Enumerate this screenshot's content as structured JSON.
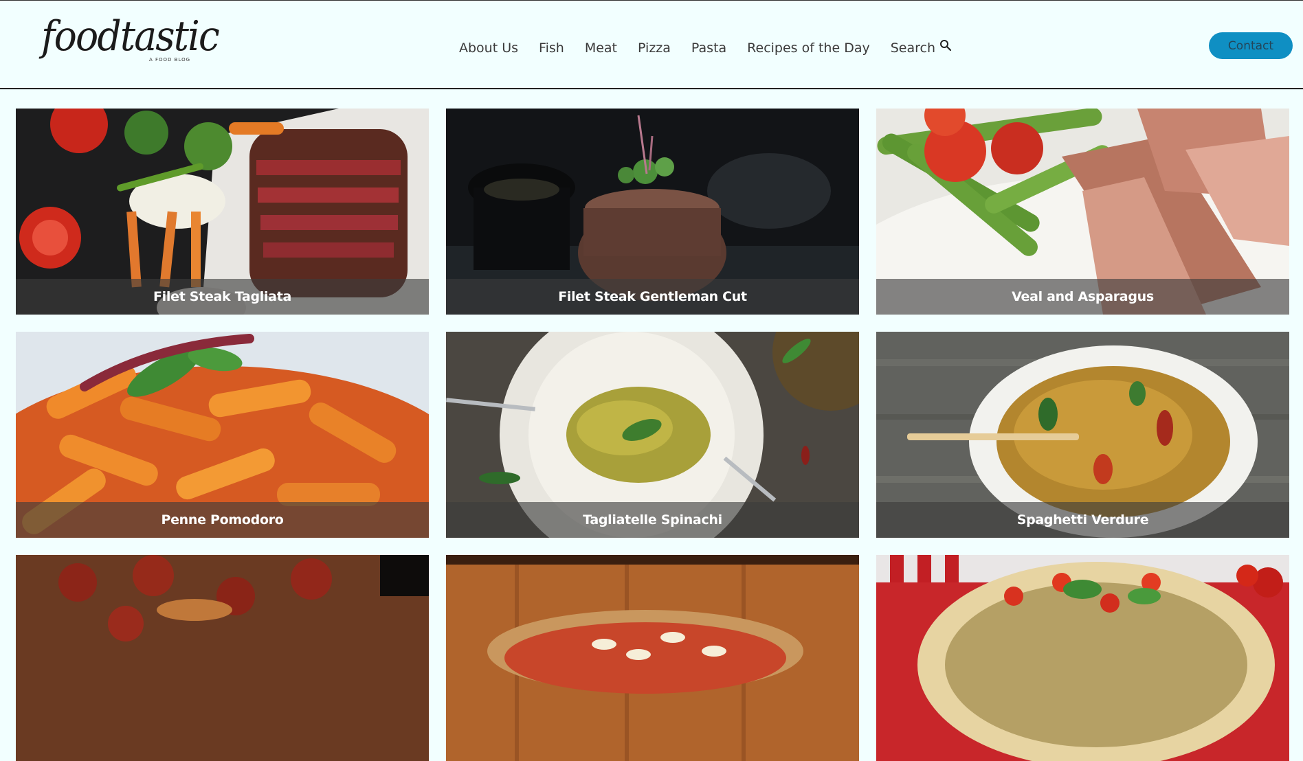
{
  "header": {
    "logo": {
      "name": "foodtastic",
      "tagline": "A FOOD BLOG"
    },
    "nav": [
      {
        "label": "About Us"
      },
      {
        "label": "Fish"
      },
      {
        "label": "Meat"
      },
      {
        "label": "Pizza"
      },
      {
        "label": "Pasta"
      },
      {
        "label": "Recipes of the Day"
      }
    ],
    "search_label": "Search",
    "search_icon": "search-icon",
    "contact_label": "Contact"
  },
  "colors": {
    "background": "#f2ffff",
    "contact_button": "#0f8fc3",
    "caption_overlay": "rgba(60,60,60,0.62)"
  },
  "recipes": [
    {
      "title": "Filet Steak Tagliata",
      "image": "sliced-steak-with-vegetables"
    },
    {
      "title": "Filet Steak Gentleman Cut",
      "image": "filet-steak-with-microgreens"
    },
    {
      "title": "Veal and Asparagus",
      "image": "veal-with-asparagus-and-tomatoes"
    },
    {
      "title": "Penne Pomodoro",
      "image": "penne-with-tomato-sauce"
    },
    {
      "title": "Tagliatelle Spinachi",
      "image": "tagliatelle-on-white-plate"
    },
    {
      "title": "Spaghetti Verdure",
      "image": "spaghetti-with-vegetables"
    },
    {
      "title": "",
      "image": "pepperoni-pizza"
    },
    {
      "title": "",
      "image": "pizza-on-wooden-table"
    },
    {
      "title": "",
      "image": "vegetable-flatbread-pizza"
    }
  ]
}
